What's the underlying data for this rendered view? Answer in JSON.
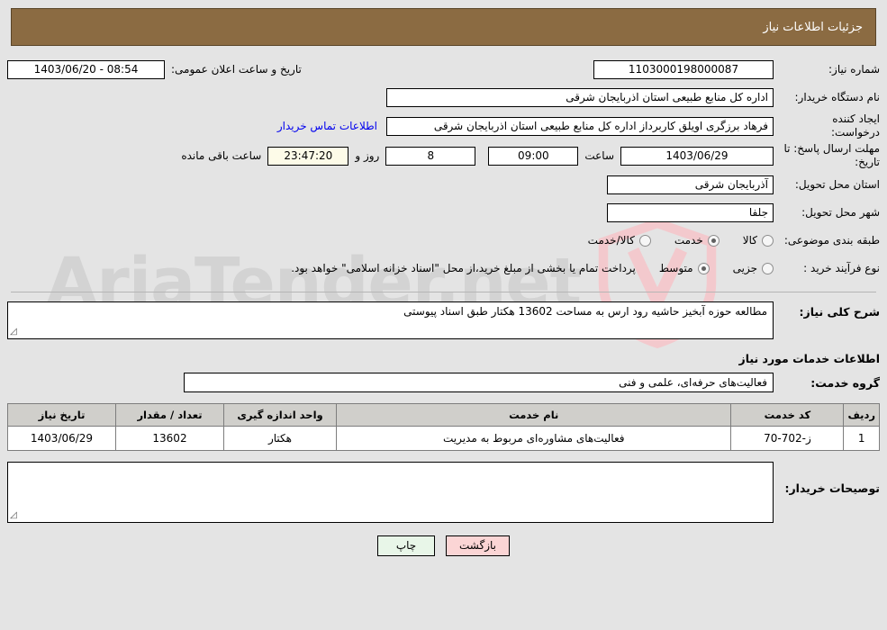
{
  "header": {
    "title": "جزئیات اطلاعات نیاز",
    "bg_color": "#8b6b42",
    "text_color": "#ffffff"
  },
  "watermark": {
    "text": "AriaTender.net",
    "shield_color": "#f3c9cd",
    "text_color": "#d3d3d3"
  },
  "form": {
    "need_number_label": "شماره نیاز:",
    "need_number_value": "1103000198000087",
    "public_announce_label": "تاریخ و ساعت اعلان عمومی:",
    "public_announce_value": "08:54 - 1403/06/20",
    "buyer_org_label": "نام دستگاه خریدار:",
    "buyer_org_value": "اداره کل منابع طبیعی استان اذربایجان شرقی",
    "creator_label": "ایجاد کننده درخواست:",
    "creator_value": "فرهاد برزگری اویلق کاربرداز اداره کل منابع طبیعی استان اذربایجان شرقی",
    "contact_link": "اطلاعات تماس خریدار",
    "deadline_label": "مهلت ارسال پاسخ: تا تاریخ:",
    "deadline_date": "1403/06/29",
    "deadline_time_label": "ساعت",
    "deadline_time": "09:00",
    "remaining_days": "8",
    "remaining_days_label": "روز و",
    "remaining_clock": "23:47:20",
    "remaining_clock_label": "ساعت باقی مانده",
    "province_label": "استان محل تحویل:",
    "province_value": "آذربایجان شرقی",
    "city_label": "شهر محل تحویل:",
    "city_value": "جلفا",
    "category_label": "طبقه بندی موضوعی:",
    "category_options": [
      {
        "label": "کالا",
        "selected": false
      },
      {
        "label": "خدمت",
        "selected": true
      },
      {
        "label": "کالا/خدمت",
        "selected": false
      }
    ],
    "process_label": "نوع فرآیند خرید :",
    "process_options": [
      {
        "label": "جزیی",
        "selected": false
      },
      {
        "label": "متوسط",
        "selected": true
      }
    ],
    "payment_note": "پرداخت تمام یا بخشی از مبلغ خرید،از محل \"اسناد خزانه اسلامی\" خواهد بود."
  },
  "description": {
    "label": "شرح کلی نیاز:",
    "value": "مطالعه حوزه آبخیز حاشیه رود ارس به مساحت 13602 هکتار طبق اسناد پیوستی"
  },
  "services": {
    "heading": "اطلاعات خدمات مورد نیاز",
    "group_label": "گروه خدمت:",
    "group_value": "فعالیت‌های حرفه‌ای، علمی و فنی",
    "columns": [
      "ردیف",
      "کد خدمت",
      "نام خدمت",
      "واحد اندازه گیری",
      "تعداد / مقدار",
      "تاریخ نیاز"
    ],
    "rows": [
      {
        "radif": "1",
        "code": "ز-702-70",
        "name": "فعالیت‌های مشاوره‌ای مربوط به مدیریت",
        "unit": "هکتار",
        "qty": "13602",
        "date": "1403/06/29"
      }
    ]
  },
  "buyer_notes": {
    "label": "توصیحات خریدار:",
    "value": ""
  },
  "buttons": {
    "print": "چاپ",
    "back": "بازگشت"
  }
}
